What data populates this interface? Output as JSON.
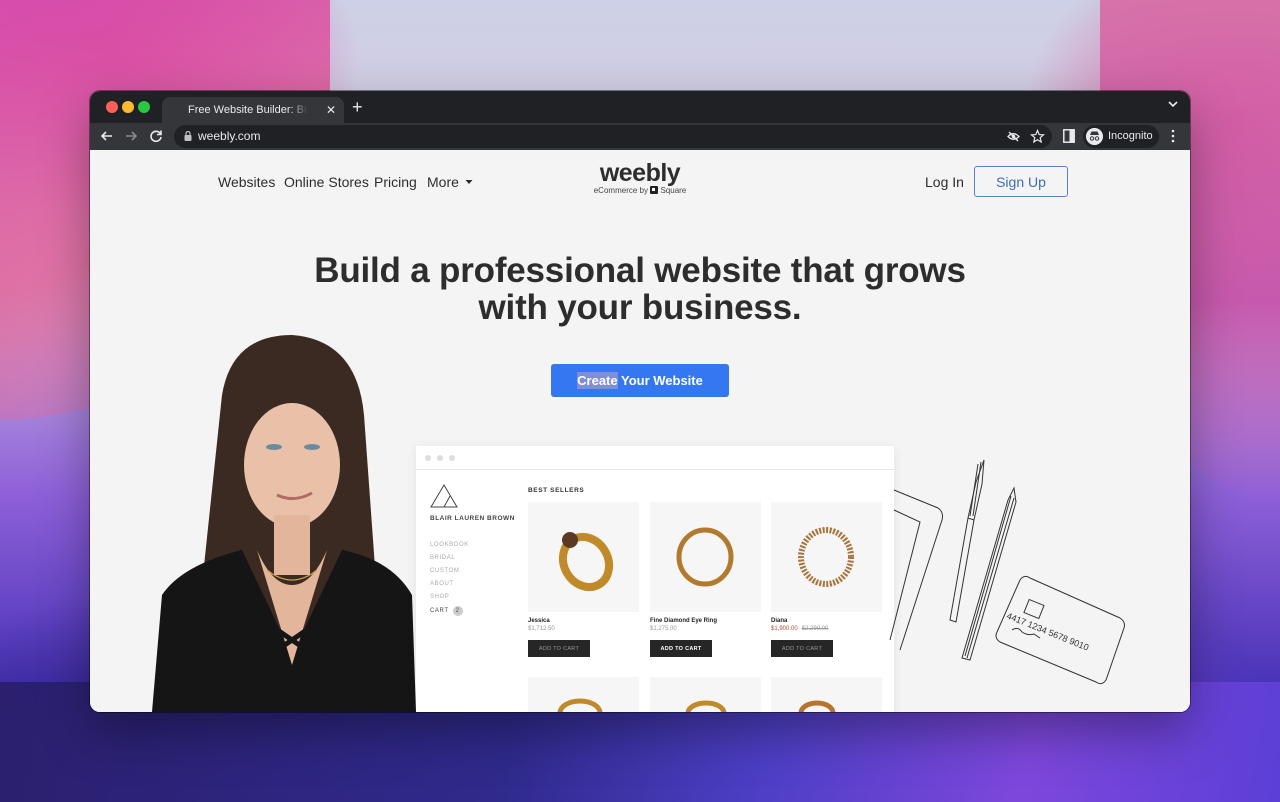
{
  "browser": {
    "tab": {
      "title": "Free Website Builder: Build a Free Website or Online Store",
      "close_icon": "close-icon"
    },
    "new_tab_icon": "plus-icon",
    "address": {
      "url": "weebly.com"
    },
    "incognito_label": "Incognito"
  },
  "site": {
    "nav": {
      "websites": "Websites",
      "online_stores": "Online Stores",
      "pricing": "Pricing",
      "more": "More"
    },
    "logo": {
      "word": "weebly",
      "sub_prefix": "eCommerce by",
      "sub_brand": "Square"
    },
    "login": "Log In",
    "signup": "Sign Up",
    "hero": {
      "line1": "Build a professional website that grows",
      "line2": "with your business."
    },
    "cta": {
      "selected": "Create",
      "rest": " Your Website"
    },
    "colors": {
      "cta": "#3577f1",
      "signup_text": "#3f6db3",
      "sale_price": "#c24a3a"
    }
  },
  "mockup": {
    "brand": "BLAIR LAUREN BROWN",
    "nav": [
      "LOOKBOOK",
      "BRIDAL",
      "CUSTOM",
      "ABOUT",
      "SHOP",
      "CART"
    ],
    "cart_count": "2",
    "section_title": "BEST SELLERS",
    "products": [
      {
        "name": "Jessica",
        "price": "$1,712.50",
        "button": "ADD TO CART"
      },
      {
        "name": "Fine Diamond Eye Ring",
        "price": "$1,275.00",
        "button": "ADD TO CART"
      },
      {
        "name": "Diana",
        "sale_price": "$1,900.00",
        "original_price": "$2,299.00",
        "button": "ADD TO CART"
      }
    ],
    "card_number": "4417 1234 5678 9010"
  }
}
